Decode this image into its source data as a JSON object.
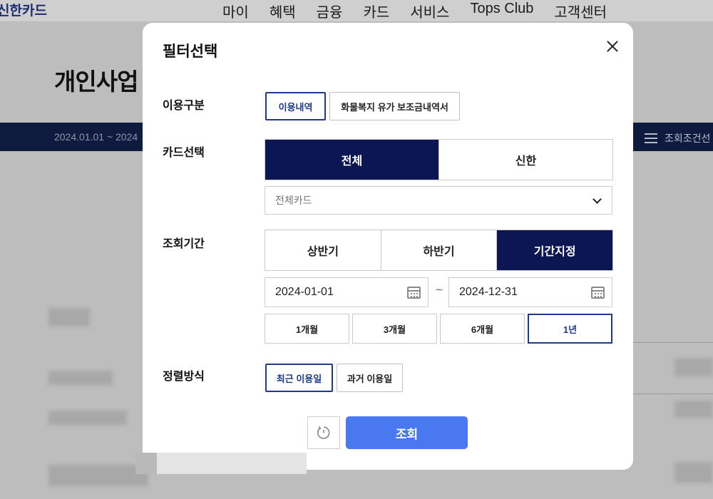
{
  "background": {
    "logo": "신한카드",
    "nav": [
      "마이",
      "혜택",
      "금융",
      "카드",
      "서비스",
      "Tops Club",
      "고객센터"
    ],
    "page_title": "개인사업",
    "period_text": "2024.01.01 ~ 2024",
    "filter_link": "조회조건선"
  },
  "modal": {
    "title": "필터선택",
    "usage_type": {
      "label": "이용구분",
      "options": [
        "이용내역",
        "화물복지 유가 보조금내역서"
      ],
      "selected": "이용내역"
    },
    "card_select": {
      "label": "카드선택",
      "tabs": [
        "전체",
        "신한"
      ],
      "selected": "전체",
      "dropdown_value": "전체카드"
    },
    "period": {
      "label": "조회기간",
      "tabs": [
        "상반기",
        "하반기",
        "기간지정"
      ],
      "selected": "기간지정",
      "start_date": "2024-01-01",
      "separator": "~",
      "end_date": "2024-12-31",
      "quick": [
        "1개월",
        "3개월",
        "6개월",
        "1년"
      ],
      "quick_selected": "1년"
    },
    "sort": {
      "label": "정렬방식",
      "options": [
        "최근 이용일",
        "과거 이용일"
      ],
      "selected": "최근 이용일"
    },
    "search_button": "조회"
  },
  "colors": {
    "navy": "#0c1652",
    "accent_blue": "#1e3a8c",
    "search_button": "#4a78f0"
  },
  "icons": [
    "close-icon",
    "chevron-down-icon",
    "calendar-icon",
    "refresh-icon",
    "filter-icon"
  ]
}
